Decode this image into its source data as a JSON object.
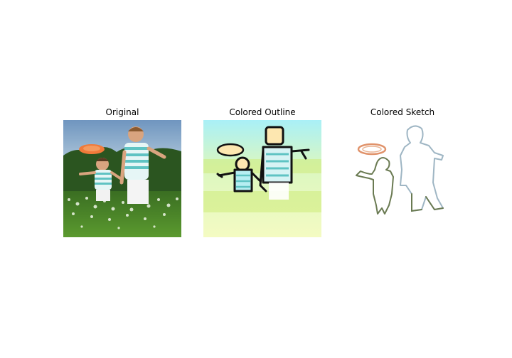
{
  "panels": [
    {
      "title": "Original"
    },
    {
      "title": "Colored Outline"
    },
    {
      "title": "Colored Sketch"
    }
  ],
  "colors": {
    "background": "#ffffff",
    "sky": "#7fa3c8",
    "foliage": "#2e5a1f",
    "grass": "#4f8a2a",
    "frisbee": "#f07a3a",
    "shirt_stripe": "#5fc3c3",
    "outline_sky": "#b8f2f5",
    "outline_grass": "#e9f7a3",
    "outline_ink": "#111111",
    "sketch_stroke": "#6a7a52"
  }
}
